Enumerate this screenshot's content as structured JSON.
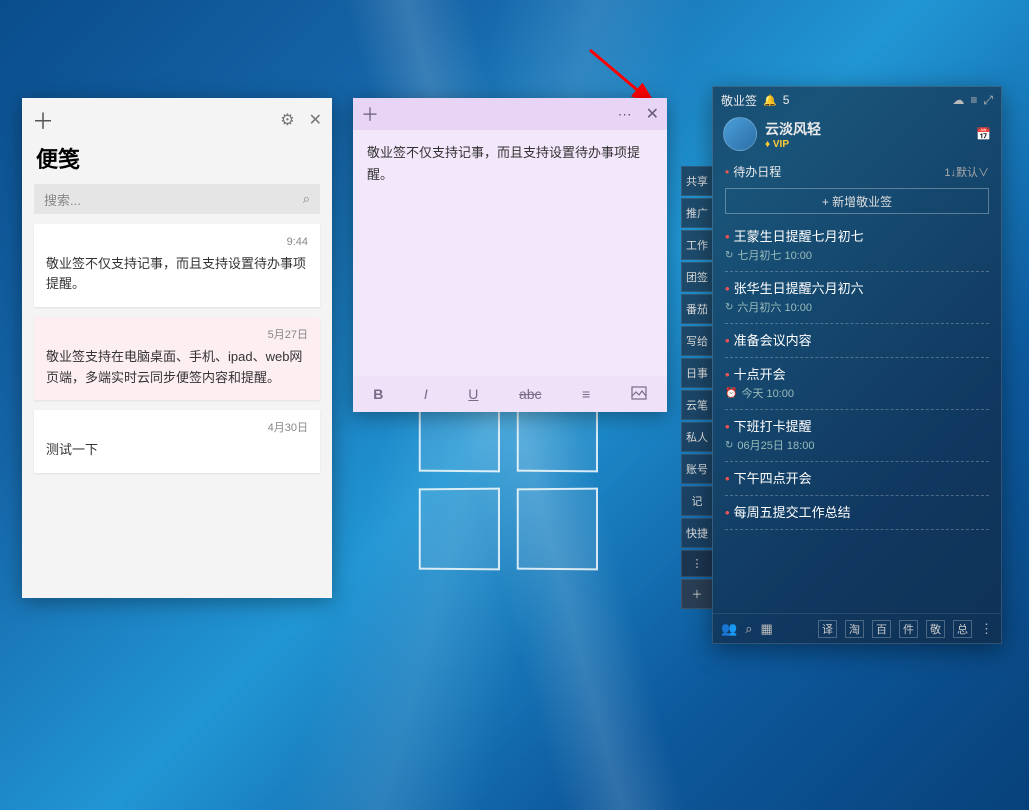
{
  "notes_list": {
    "title": "便笺",
    "search_placeholder": "搜索...",
    "cards": [
      {
        "date": "9:44",
        "text": "敬业签不仅支持记事，而且支持设置待办事项提醒。"
      },
      {
        "date": "5月27日",
        "text": "敬业签支持在电脑桌面、手机、ipad、web网页端，多端实时云同步便签内容和提醒。"
      },
      {
        "date": "4月30日",
        "text": "测试一下"
      }
    ]
  },
  "note_editor": {
    "body": "敬业签不仅支持记事，而且支持设置待办事项提醒。",
    "toolbar": {
      "bold": "B",
      "italic": "I",
      "underline": "U",
      "strike": "abc",
      "list": "≡",
      "image": "▭"
    }
  },
  "jyq": {
    "app_name": "敬业签",
    "notif_count": "5",
    "username": "云淡风轻",
    "vip_label": "VIP",
    "section_title": "待办日程",
    "sort_label": "1↓默认∨",
    "add_label": "+ 新增敬业签",
    "items": [
      {
        "title": "王蒙生日提醒七月初七",
        "meta_icon": "↻",
        "meta": "七月初七 10:00"
      },
      {
        "title": "张华生日提醒六月初六",
        "meta_icon": "↻",
        "meta": "六月初六 10:00"
      },
      {
        "title": "准备会议内容",
        "meta_icon": "",
        "meta": ""
      },
      {
        "title": "十点开会",
        "meta_icon": "⏰",
        "meta": "今天 10:00"
      },
      {
        "title": "下班打卡提醒",
        "meta_icon": "↻",
        "meta": "06月25日 18:00"
      },
      {
        "title": "下午四点开会",
        "meta_icon": "",
        "meta": ""
      },
      {
        "title": "每周五提交工作总结",
        "meta_icon": "",
        "meta": ""
      }
    ],
    "bottom_tags": [
      "译",
      "淘",
      "百",
      "件",
      "敬",
      "总"
    ]
  },
  "sidetabs": [
    "共享",
    "推广",
    "工作",
    "团签",
    "番茄",
    "写给",
    "日事",
    "云笔",
    "私人",
    "账号",
    "记",
    "快捷"
  ]
}
